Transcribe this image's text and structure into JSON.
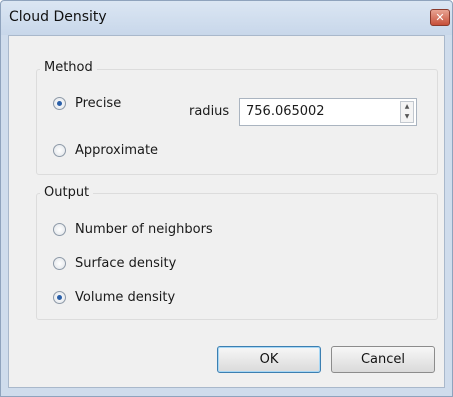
{
  "window": {
    "title": "Cloud Density",
    "close_glyph": "✕"
  },
  "method": {
    "title": "Method",
    "options": [
      {
        "label": "Precise",
        "checked": true
      },
      {
        "label": "Approximate",
        "checked": false
      }
    ],
    "radius_label": "radius",
    "radius_value": "756.065002"
  },
  "output": {
    "title": "Output",
    "options": [
      {
        "label": "Number of neighbors",
        "checked": false
      },
      {
        "label": "Surface density",
        "checked": false
      },
      {
        "label": "Volume density",
        "checked": true
      }
    ]
  },
  "buttons": {
    "ok": "OK",
    "cancel": "Cancel"
  },
  "icons": {
    "spin_up": "up-arrow-icon",
    "spin_down": "down-arrow-icon",
    "close": "close-icon"
  }
}
